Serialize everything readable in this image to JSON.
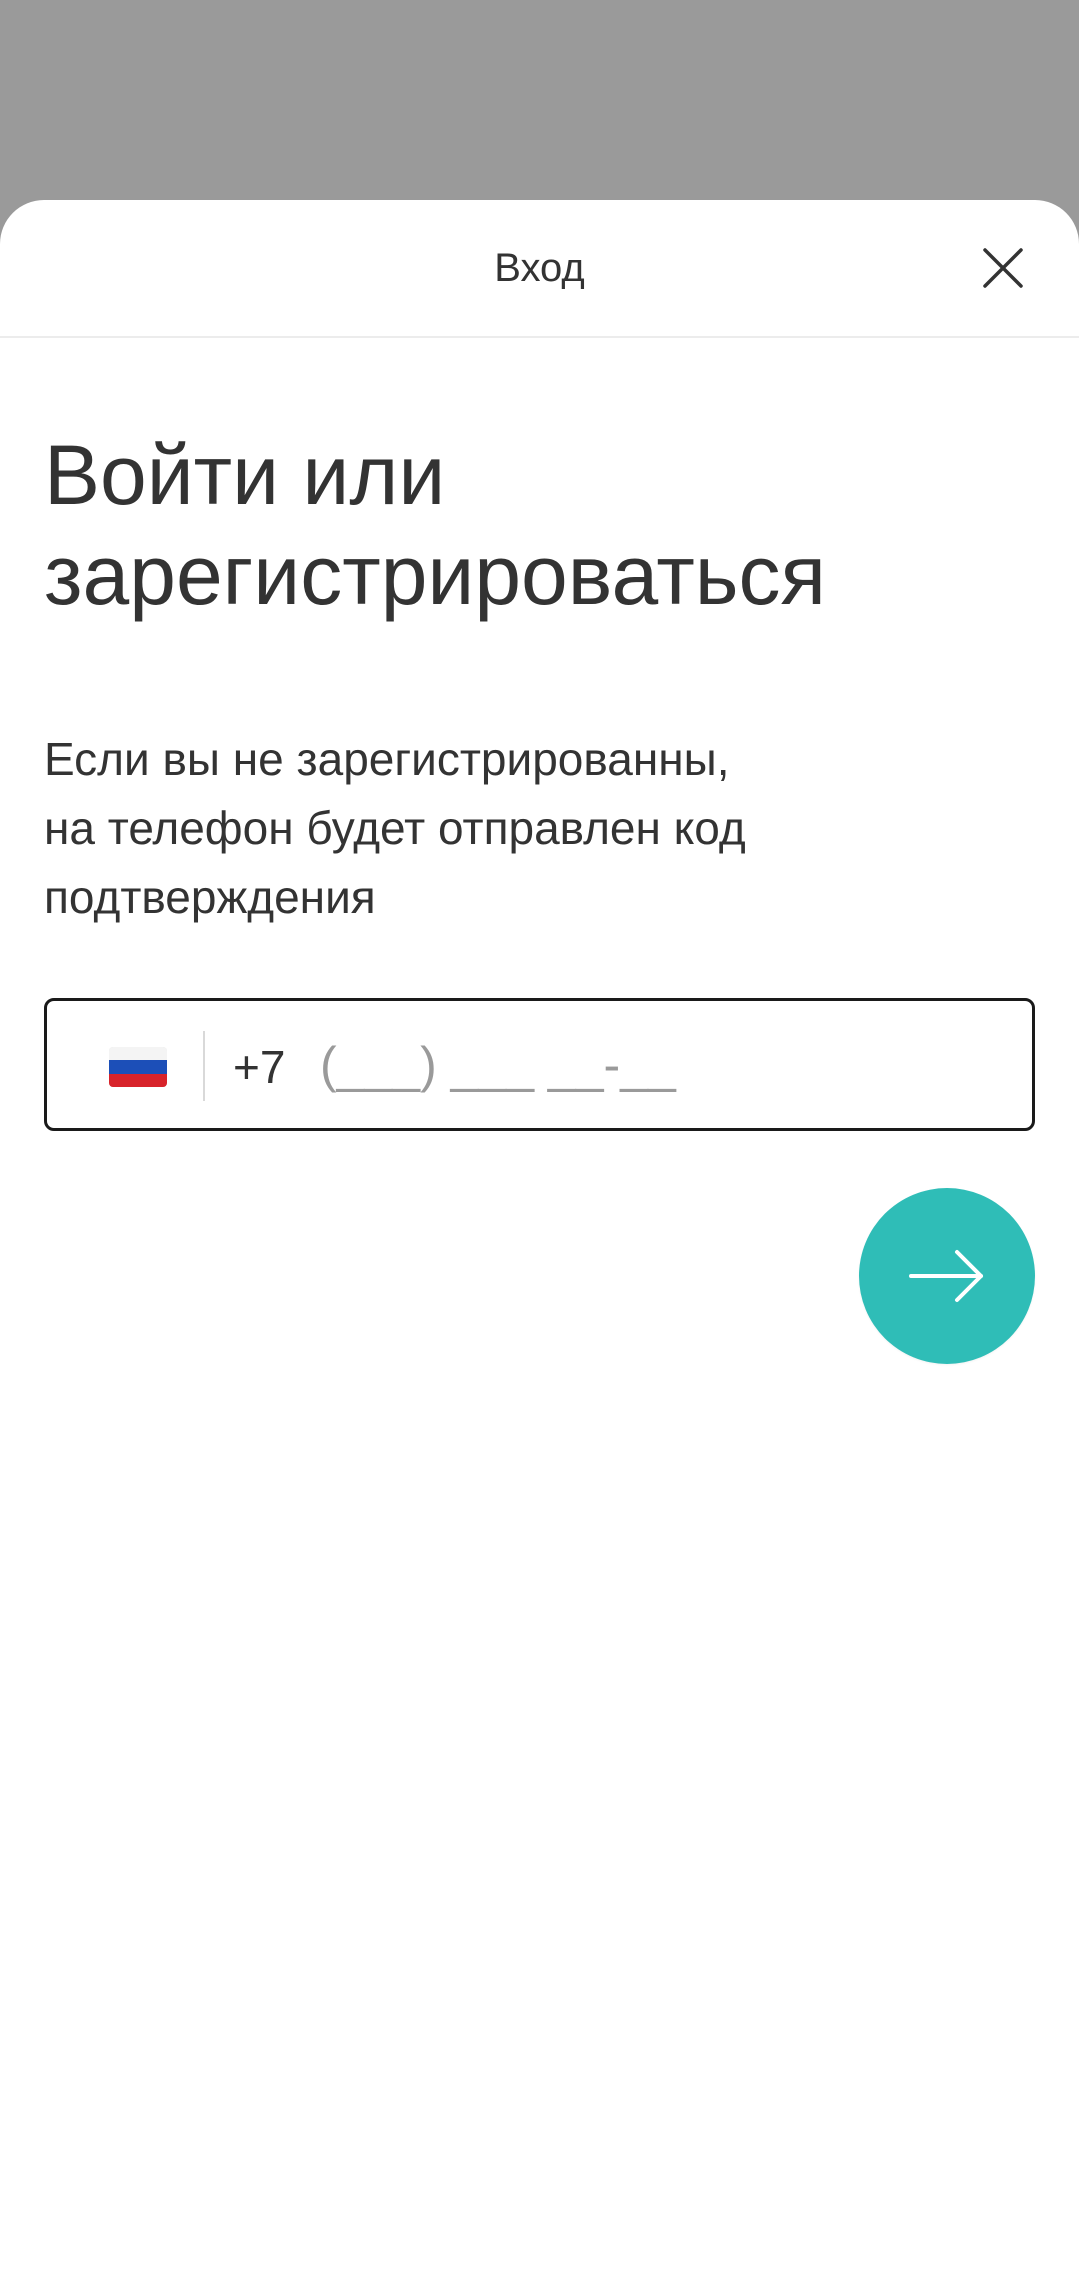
{
  "header": {
    "title": "Вход",
    "close_icon": "close-icon"
  },
  "main": {
    "heading_line1": "Войти или",
    "heading_line2": "зарегистрироваться",
    "description_line1": "Если вы не зарегистрированны,",
    "description_line2": "на телефон будет отправлен код",
    "description_line3": "подтверждения"
  },
  "phone": {
    "country_flag": "russia-flag-icon",
    "prefix": "+7",
    "value": "",
    "placeholder": "(___) ___ __-__"
  },
  "actions": {
    "next_icon": "arrow-right-icon"
  },
  "colors": {
    "accent": "#2fbdb7",
    "overlay": "#9a9a9a",
    "text": "#333333",
    "placeholder": "#9a9a9a",
    "field_border": "#1a1a1a"
  }
}
